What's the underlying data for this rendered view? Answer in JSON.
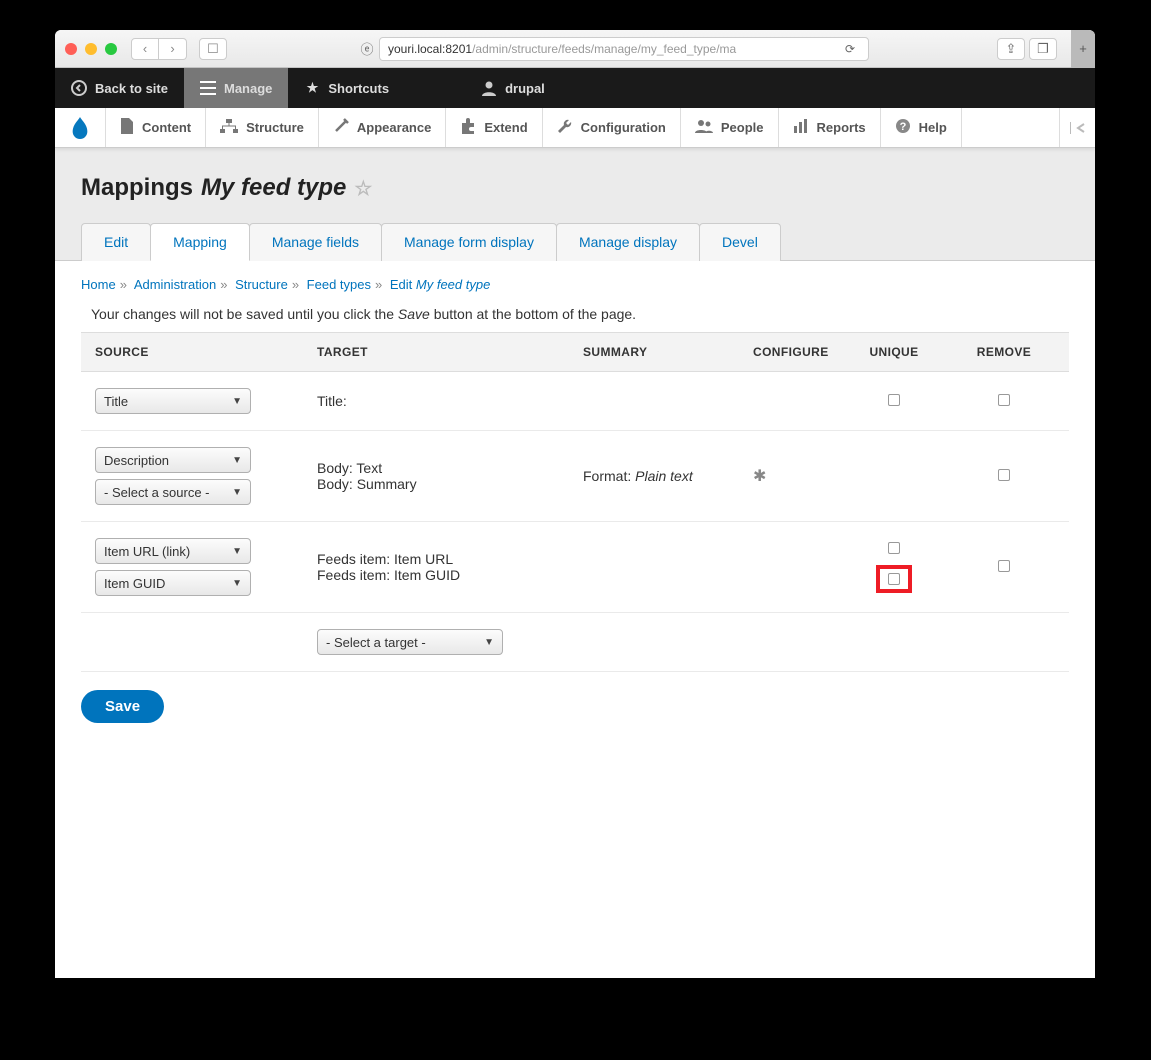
{
  "url": {
    "host": "youri.local:8201",
    "path": "/admin/structure/feeds/manage/my_feed_type/ma"
  },
  "toolbar": {
    "back": "Back to site",
    "manage": "Manage",
    "shortcuts": "Shortcuts",
    "user": "drupal"
  },
  "admin_menu": {
    "content": "Content",
    "structure": "Structure",
    "appearance": "Appearance",
    "extend": "Extend",
    "configuration": "Configuration",
    "people": "People",
    "reports": "Reports",
    "help": "Help"
  },
  "page": {
    "title_prefix": "Mappings",
    "title_em": "My feed type"
  },
  "tabs": {
    "edit": "Edit",
    "mapping": "Mapping",
    "manage_fields": "Manage fields",
    "manage_form": "Manage form display",
    "manage_display": "Manage display",
    "devel": "Devel"
  },
  "breadcrumb": {
    "home": "Home",
    "admin": "Administration",
    "structure": "Structure",
    "feed_types": "Feed types",
    "edit": "Edit",
    "feed_name": "My feed type"
  },
  "notice": {
    "pre": "Your changes will not be saved until you click the ",
    "em": "Save",
    "post": " button at the bottom of the page."
  },
  "table": {
    "headers": {
      "source": "SOURCE",
      "target": "TARGET",
      "summary": "SUMMARY",
      "configure": "CONFIGURE",
      "unique": "UNIQUE",
      "remove": "REMOVE"
    }
  },
  "rows": {
    "r1": {
      "source1": "Title",
      "target": "Title:"
    },
    "r2": {
      "source1": "Description",
      "source2": "- Select a source -",
      "target1": "Body: Text",
      "target2": "Body: Summary",
      "summary_label": "Format: ",
      "summary_val": "Plain text"
    },
    "r3": {
      "source1": "Item URL (link)",
      "source2": "Item GUID",
      "target1": "Feeds item: Item URL",
      "target2": "Feeds item: Item GUID"
    },
    "r4": {
      "target_select": "- Select a target -"
    }
  },
  "buttons": {
    "save": "Save"
  }
}
